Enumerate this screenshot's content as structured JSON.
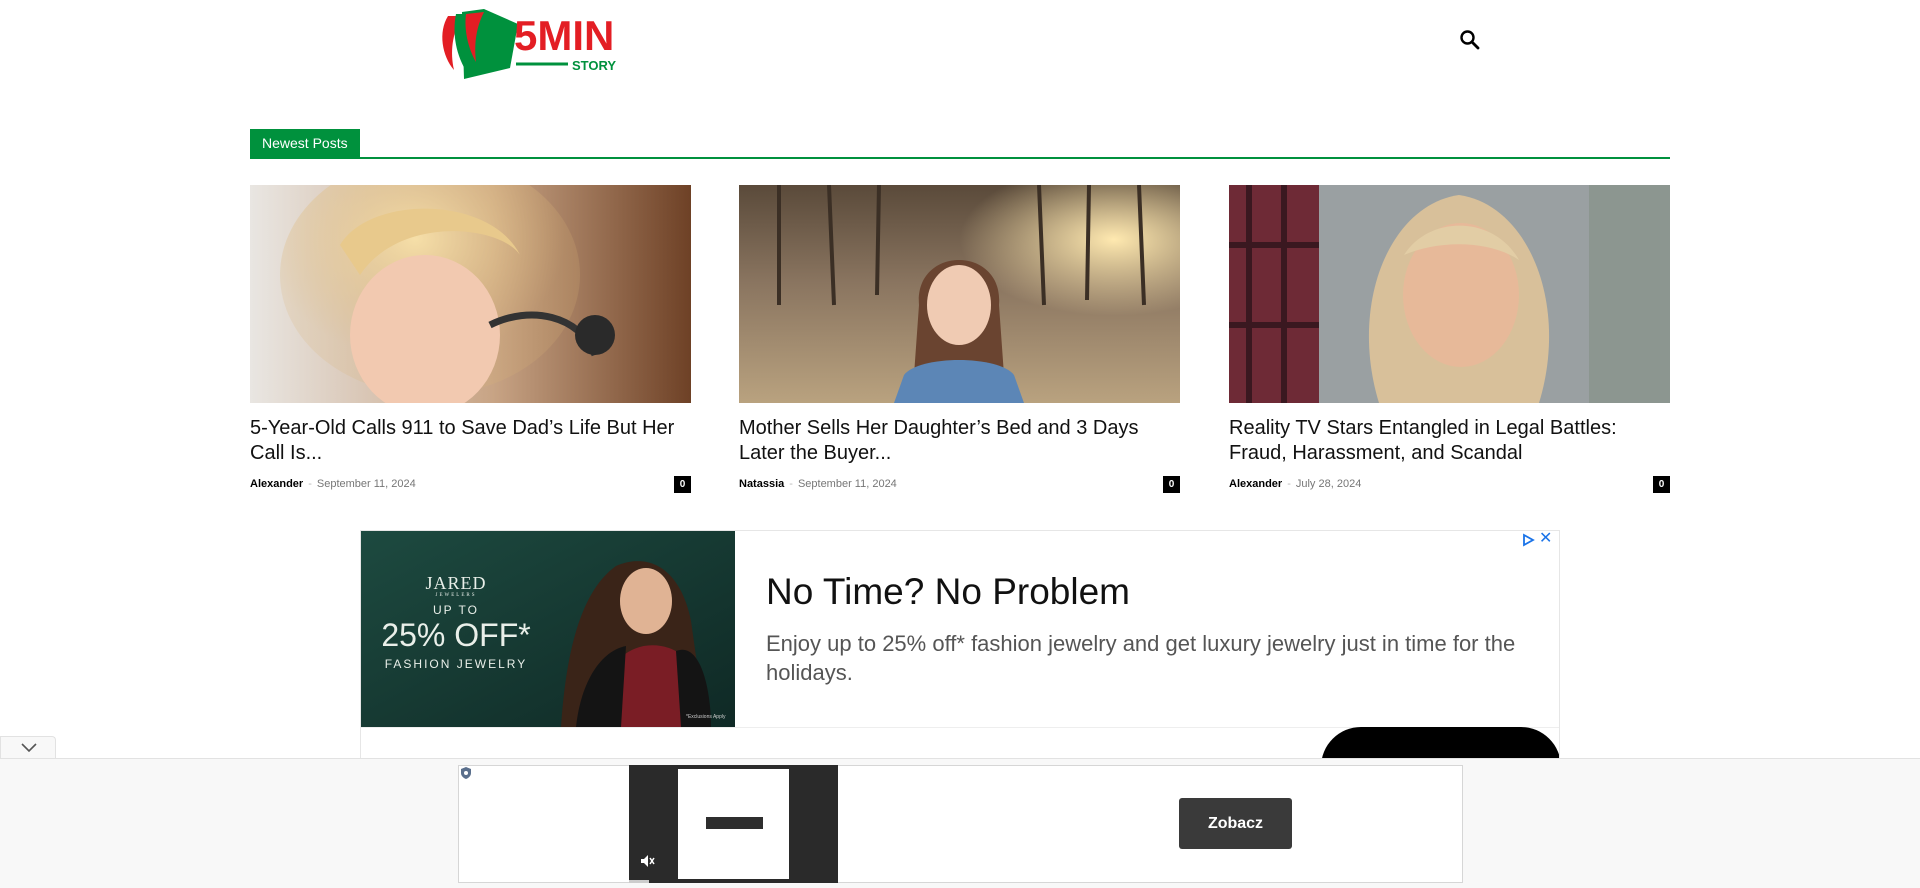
{
  "header": {
    "logo_text": "5MIN",
    "logo_subtext": "STORY",
    "search_icon": "search-icon"
  },
  "section": {
    "title": "Newest Posts"
  },
  "posts": [
    {
      "title": "5-Year-Old Calls 911 to Save Dad’s Life But Her Call Is...",
      "author": "Alexander",
      "separator": "-",
      "date": "September 11, 2024",
      "comments": "0"
    },
    {
      "title": "Mother Sells Her Daughter’s Bed and 3 Days Later the Buyer...",
      "author": "Natassia",
      "separator": "-",
      "date": "September 11, 2024",
      "comments": "0"
    },
    {
      "title": "Reality TV Stars Entangled in Legal Battles: Fraud, Harassment, and Scandal",
      "author": "Alexander",
      "separator": "-",
      "date": "July 28, 2024",
      "comments": "0"
    }
  ],
  "ad": {
    "brand": "JARED",
    "brand_sub": "JEWELERS",
    "up_to": "UP TO",
    "discount": "25% OFF*",
    "category": "FASHION JEWELRY",
    "fine_print": "*Exclusions Apply",
    "headline": "No Time? No Problem",
    "body": "Enjoy up to 25% off* fashion jewelry and get luxury jewelry just in time for the holidays.",
    "close_symbol": "✕"
  },
  "sticky_ad": {
    "cta_label": "Zobacz",
    "collapse_icon": "chevron-down-icon",
    "mute_icon": "muted-speaker-icon"
  },
  "colors": {
    "brand_green": "#00913d",
    "logo_red": "#e31e24",
    "ad_bg_green": "#173a33"
  }
}
